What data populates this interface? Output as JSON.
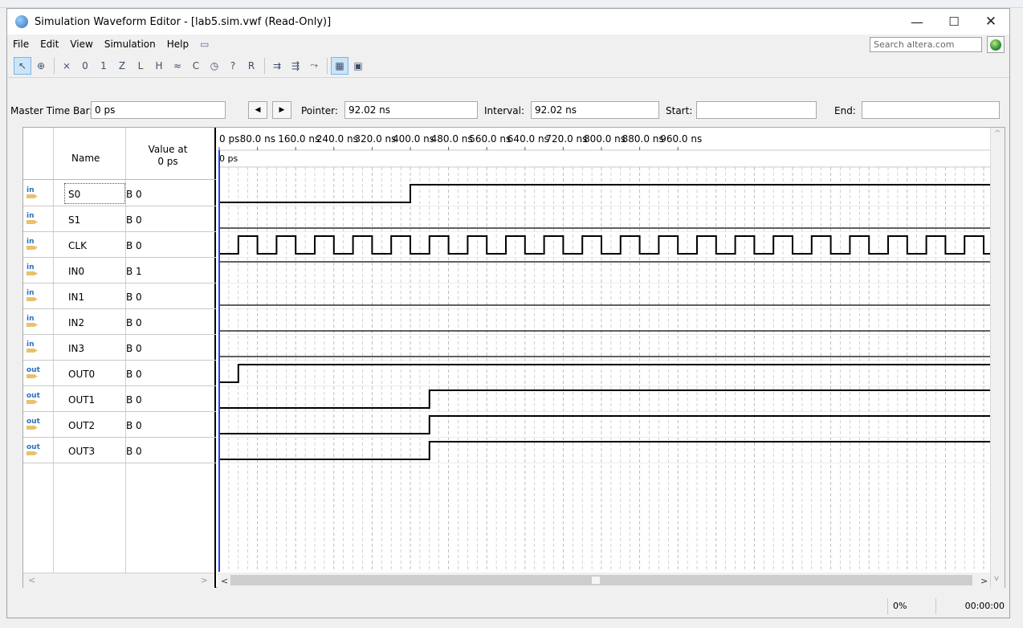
{
  "window": {
    "title": "Simulation Waveform Editor - [lab5.sim.vwf (Read-Only)]"
  },
  "menu": [
    "File",
    "Edit",
    "View",
    "Simulation",
    "Help"
  ],
  "search": {
    "placeholder": "Search altera.com"
  },
  "timebar": {
    "master_label": "Master Time Bar:",
    "master_value": "0 ps",
    "pointer_label": "Pointer:",
    "pointer_value": "92.02 ns",
    "interval_label": "Interval:",
    "interval_value": "92.02 ns",
    "start_label": "Start:",
    "start_value": "",
    "end_label": "End:",
    "end_value": ""
  },
  "table_header": {
    "name": "Name",
    "value_line1": "Value at",
    "value_line2": "0 ps"
  },
  "time_axis": {
    "ticks": [
      "0 ps",
      "80.0 ns",
      "160.0 ns",
      "240.0 ns",
      "320.0 ns",
      "400.0 ns",
      "480.0 ns",
      "560.0 ns",
      "640.0 ns",
      "720.0 ns",
      "800.0 ns",
      "880.0 ns",
      "960.0 ns"
    ],
    "ns_per_tick": 80,
    "cursor_label": "0 ps"
  },
  "signals": [
    {
      "type": "in",
      "name": "S0",
      "value": "B 0",
      "wave": {
        "kind": "step",
        "initial": 0,
        "toggles": [
          400
        ]
      }
    },
    {
      "type": "in",
      "name": "S1",
      "value": "B 0",
      "wave": {
        "kind": "step",
        "initial": 0,
        "toggles": []
      }
    },
    {
      "type": "in",
      "name": "CLK",
      "value": "B 0",
      "wave": {
        "kind": "clock",
        "initial": 0,
        "half_period": 40
      }
    },
    {
      "type": "in",
      "name": "IN0",
      "value": "B 1",
      "wave": {
        "kind": "step",
        "initial": 1,
        "toggles": []
      }
    },
    {
      "type": "in",
      "name": "IN1",
      "value": "B 0",
      "wave": {
        "kind": "step",
        "initial": 0,
        "toggles": []
      }
    },
    {
      "type": "in",
      "name": "IN2",
      "value": "B 0",
      "wave": {
        "kind": "step",
        "initial": 0,
        "toggles": []
      }
    },
    {
      "type": "in",
      "name": "IN3",
      "value": "B 0",
      "wave": {
        "kind": "step",
        "initial": 0,
        "toggles": []
      }
    },
    {
      "type": "out",
      "name": "OUT0",
      "value": "B 0",
      "wave": {
        "kind": "step",
        "initial": 0,
        "toggles": [
          40
        ]
      }
    },
    {
      "type": "out",
      "name": "OUT1",
      "value": "B 0",
      "wave": {
        "kind": "step",
        "initial": 0,
        "toggles": [
          440
        ]
      }
    },
    {
      "type": "out",
      "name": "OUT2",
      "value": "B 0",
      "wave": {
        "kind": "step",
        "initial": 0,
        "toggles": [
          440
        ]
      }
    },
    {
      "type": "out",
      "name": "OUT3",
      "value": "B 0",
      "wave": {
        "kind": "step",
        "initial": 0,
        "toggles": [
          440
        ]
      }
    }
  ],
  "status": {
    "progress": "0%",
    "elapsed": "00:00:00"
  },
  "colors": {
    "cursor": "#2244dd",
    "wave": "#000000",
    "grid": "#b5b5b5",
    "icon_in": "#2d6fc0"
  }
}
